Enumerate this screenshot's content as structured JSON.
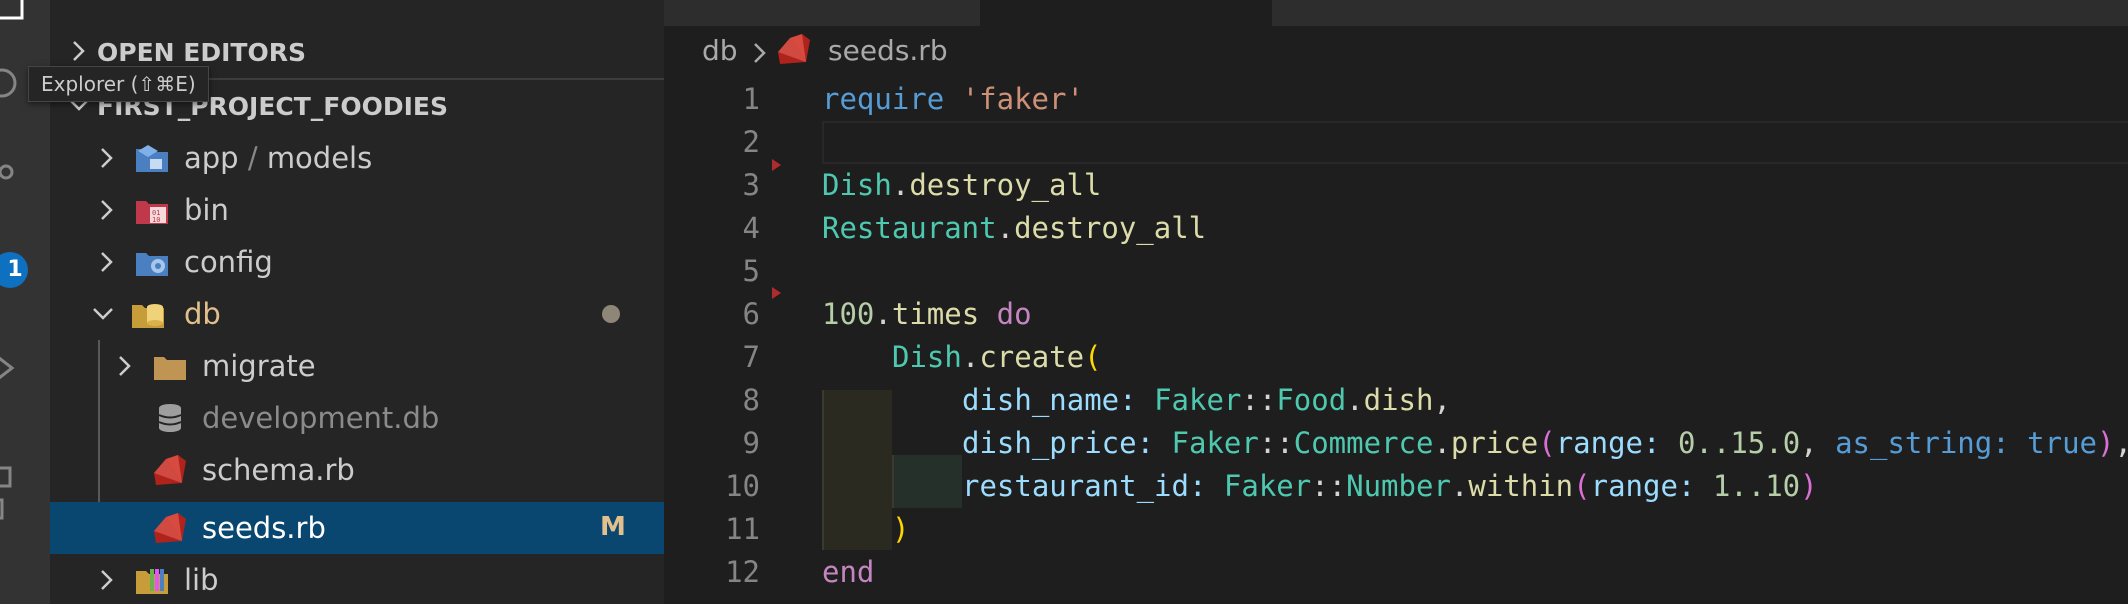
{
  "tooltip": {
    "text": "Explorer (⇧⌘E)"
  },
  "activity": {
    "badge_count": "1"
  },
  "sidebar": {
    "open_editors": "OPEN EDITORS",
    "project": "FIRST_PROJECT_FOODIES",
    "items": [
      {
        "folder": "app",
        "sep": "/",
        "sub": "models",
        "icon": "app-folder-icon"
      },
      {
        "name": "bin",
        "icon": "bin-folder-icon"
      },
      {
        "name": "config",
        "icon": "config-folder-icon"
      },
      {
        "name": "db",
        "icon": "db-folder-icon"
      },
      {
        "name": "migrate",
        "icon": "folder-icon"
      },
      {
        "name": "development.db",
        "icon": "database-icon"
      },
      {
        "name": "schema.rb",
        "icon": "ruby-icon"
      },
      {
        "name": "seeds.rb",
        "icon": "ruby-icon",
        "badge": "M"
      },
      {
        "name": "lib",
        "icon": "lib-folder-icon"
      }
    ]
  },
  "breadcrumb": {
    "folder": "db",
    "file": "seeds.rb"
  },
  "editor": {
    "line_numbers": [
      "1",
      "2",
      "3",
      "4",
      "5",
      "6",
      "7",
      "8",
      "9",
      "10",
      "11",
      "12"
    ],
    "tokens": {
      "l1_require": "require",
      "l1_str": "'faker'",
      "dish": "Dish",
      "dot": ".",
      "destroy_all": "destroy_all",
      "restaurant": "Restaurant",
      "n100": "100",
      "times": "times",
      "do": "do",
      "create": "create",
      "paren_open": "(",
      "paren_close": ")",
      "dish_name_key": "dish_name:",
      "faker": "Faker",
      "scope": "::",
      "food": "Food",
      "dish_m": "dish",
      "comma": ",",
      "dish_price_key": "dish_price:",
      "commerce": "Commerce",
      "price": "price",
      "range_key": "range:",
      "range_val": "0..15.0",
      "as_string_key": "as_string:",
      "true_val": "true",
      "restaurant_id_key": "restaurant_id:",
      "number": "Number",
      "within": "within",
      "range_val2": "1..10",
      "end": "end"
    }
  },
  "colors": {
    "selection": "#094771",
    "modified": "#e2c08d",
    "badge": "#0e70c0"
  }
}
